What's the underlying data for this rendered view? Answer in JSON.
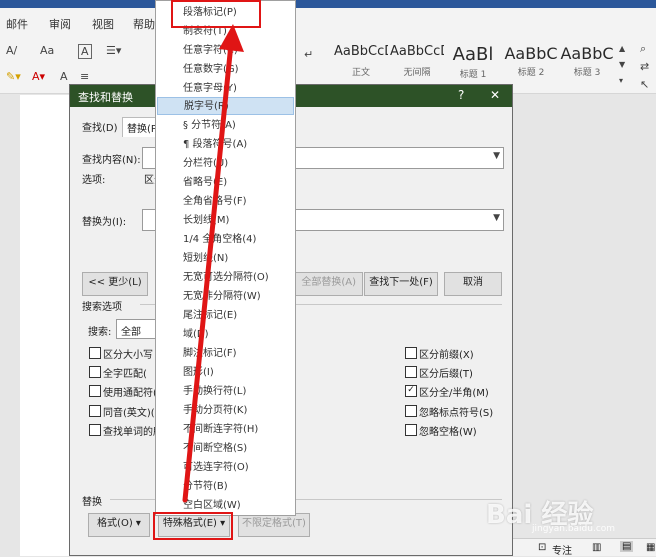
{
  "ribbon": {
    "tabs": [
      "邮件",
      "审阅",
      "视图",
      "帮助"
    ],
    "styles": [
      {
        "sample": "AaBbCcD",
        "name": "正文"
      },
      {
        "sample": "AaBbCcD",
        "name": "无间隔"
      },
      {
        "sample": "AaBl",
        "name": "标题 1"
      },
      {
        "sample": "AaBbC",
        "name": "标题 2"
      },
      {
        "sample": "AaBbC",
        "name": "标题 3"
      }
    ]
  },
  "dialog": {
    "title": "查找和替换",
    "help": "?",
    "close": "✕",
    "tabs": {
      "find": "查找(D)",
      "replace": "替换(P)"
    },
    "find_label": "查找内容(N):",
    "options_label": "选项:",
    "options_value": "区分",
    "replace_label": "替换为(I):",
    "less_button": "<< 更少(L)",
    "replace_all_button": "全部替换(A)",
    "find_next_button": "查找下一处(F)",
    "cancel_button": "取消",
    "search_options_title": "搜索选项",
    "search_label": "搜索:",
    "search_value": "全部",
    "left_options": [
      "区分大小写",
      "全字匹配(",
      "使用通配符(",
      "同音(英文)(K",
      "查找单词的所"
    ],
    "right_options": [
      {
        "label": "区分前缀(X)",
        "checked": false
      },
      {
        "label": "区分后缀(T)",
        "checked": false
      },
      {
        "label": "区分全/半角(M)",
        "checked": true
      },
      {
        "label": "忽略标点符号(S)",
        "checked": false
      },
      {
        "label": "忽略空格(W)",
        "checked": false
      }
    ],
    "replace_section_title": "替换",
    "format_button": "格式(O) ▾",
    "special_button": "特殊格式(E) ▾",
    "no_format_button": "不限定格式(T)"
  },
  "menu": {
    "items": [
      "段落标记(P)",
      "制表符(T)",
      "任意字符(C)",
      "任意数字(G)",
      "任意字母(Y)",
      "脱字号(R)",
      "§ 分节符(A)",
      "¶ 段落符号(A)",
      "分栏符(U)",
      "省略号(E)",
      "全角省略号(F)",
      "长划线(M)",
      "1/4 全角空格(4)",
      "短划线(N)",
      "无宽可选分隔符(O)",
      "无宽非分隔符(W)",
      "尾注标记(E)",
      "域(D)",
      "脚注标记(F)",
      "图形(I)",
      "手动换行符(L)",
      "手动分页符(K)",
      "不间断连字符(H)",
      "不间断空格(S)",
      "可选连字符(O)",
      "分节符(B)",
      "空白区域(W)"
    ],
    "highlighted_index": 5
  },
  "statusbar": {
    "focus": "专注"
  },
  "watermark": {
    "text": "Bai 经验",
    "url": "jingyan.baidu.com"
  }
}
